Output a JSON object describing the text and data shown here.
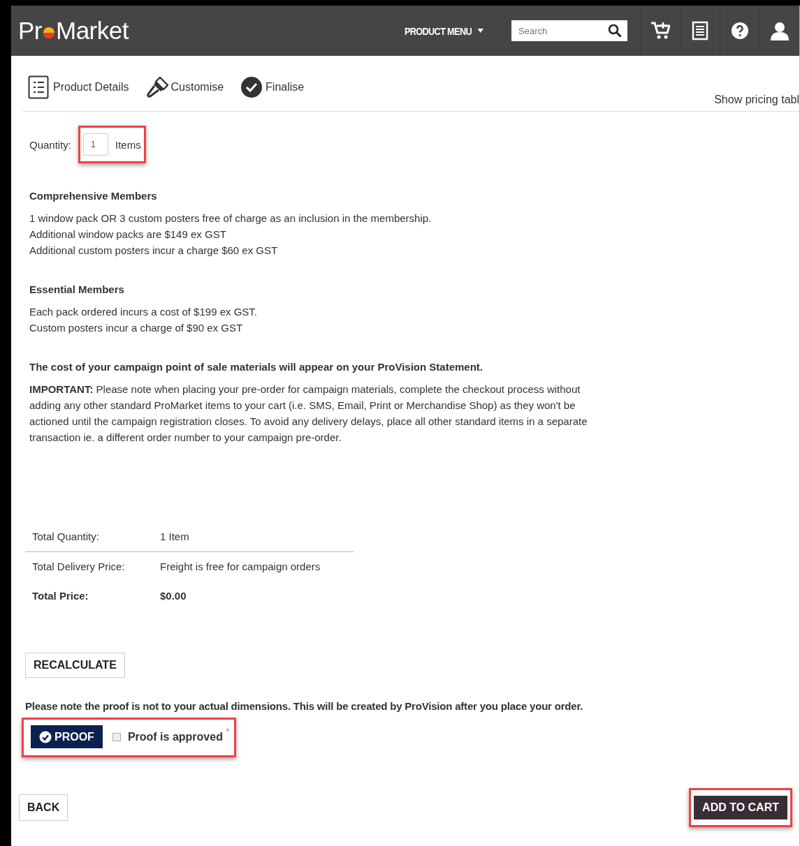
{
  "header": {
    "logo": {
      "before": "Pr",
      "after": "Market"
    },
    "menu": "PRODUCT MENU",
    "search": {
      "placeholder": "Search"
    }
  },
  "steps": [
    {
      "label": "Product Details",
      "kind": "list"
    },
    {
      "label": "Customise",
      "kind": "brush"
    },
    {
      "label": "Finalise",
      "kind": "check"
    }
  ],
  "pricing_link": "Show pricing tabl",
  "quantity": {
    "label": "Quantity:",
    "value": "1",
    "unit": "Items",
    "highlighted": true
  },
  "sections": [
    {
      "heading": "Comprehensive Members",
      "lines": [
        "1 window pack OR 3 custom posters free of charge as an inclusion in the membership.",
        "Additional window packs are $149 ex GST",
        "Additional custom posters incur a charge $60 ex GST"
      ]
    },
    {
      "heading": "Essential Members",
      "lines": [
        "Each pack ordered incurs a cost of $199 ex GST.",
        "Custom posters incur a charge of $90 ex GST"
      ]
    }
  ],
  "statement": "The cost of your campaign point of sale materials will appear on your ProVision Statement.",
  "important": "**IMPORTANT:** Please note when placing your pre-order for campaign materials, complete the checkout process without adding any other standard ProMarket items to your cart (i.e. SMS, Email, Print or Merchandise Shop) as they won't be actioned until the campaign registration closes. To avoid any delivery delays, place all other standard items in a separate transaction ie. a different order number to your campaign pre-order.",
  "summary": [
    {
      "label": "Total Quantity:",
      "value": "1 Item",
      "bold": false
    },
    {
      "label": "Total Delivery Price:",
      "value": "Freight is free for campaign orders",
      "bold": false
    },
    {
      "label": "Total Price:",
      "value": "$0.00",
      "bold": true
    }
  ],
  "recalculate": "RECALCULATE",
  "proof_note": "Please note the proof is not to your actual dimensions. This will be created by ProVision after you place your order.",
  "proof": {
    "button": "PROOF",
    "checkbox_label": "Proof is approved",
    "required_mark": "*",
    "checked": false,
    "highlighted": true
  },
  "back": "BACK",
  "add_to_cart": {
    "label": "ADD TO CART",
    "highlighted": true
  }
}
